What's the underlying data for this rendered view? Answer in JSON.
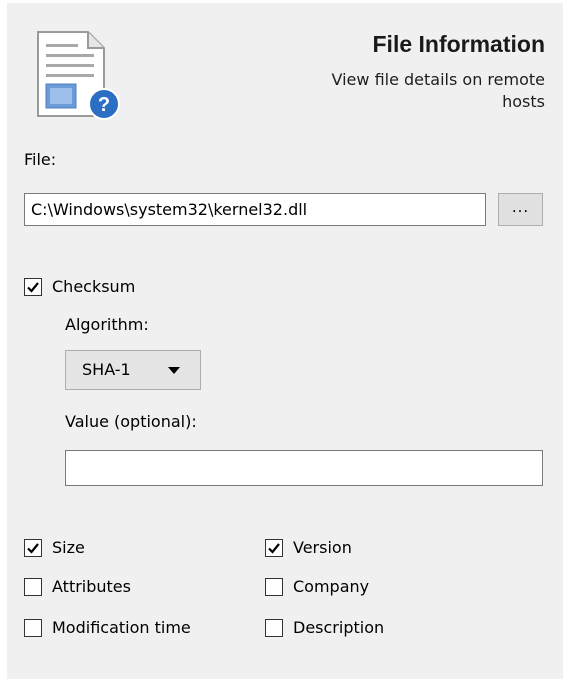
{
  "header": {
    "title": "File Information",
    "subtitle": "View file details on remote hosts",
    "icon": "file-info-icon"
  },
  "file": {
    "label": "File:",
    "value": "C:\\Windows\\system32\\kernel32.dll",
    "browse_label": "..."
  },
  "checksum": {
    "label": "Checksum",
    "checked": true,
    "algorithm_label": "Algorithm:",
    "algorithm_value": "SHA-1",
    "value_label": "Value (optional):",
    "value": ""
  },
  "options": {
    "size": {
      "label": "Size",
      "checked": true
    },
    "attributes": {
      "label": "Attributes",
      "checked": false
    },
    "modification_time": {
      "label": "Modification time",
      "checked": false
    },
    "version": {
      "label": "Version",
      "checked": true
    },
    "company": {
      "label": "Company",
      "checked": false
    },
    "description": {
      "label": "Description",
      "checked": false
    }
  },
  "colors": {
    "panel_bg": "#f0f0f0",
    "icon_badge": "#2b6fc4"
  }
}
